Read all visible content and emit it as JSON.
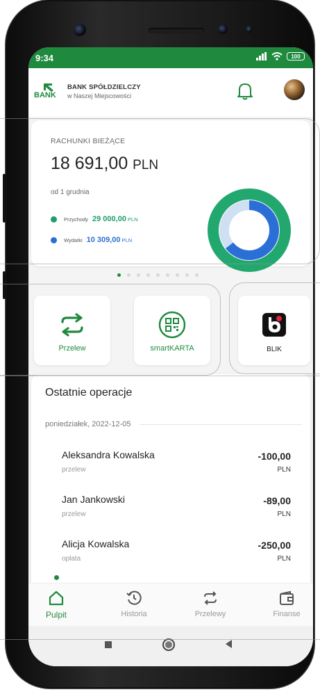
{
  "status_bar": {
    "time": "9:34",
    "battery": "100"
  },
  "header": {
    "logo_text": "BANK",
    "bank_line1": "BANK SPÓŁDZIELCZY",
    "bank_line2": "w Naszej Miejscowości"
  },
  "account_card": {
    "title": "RACHUNKI BIEŻĄCE",
    "balance": "18 691,00",
    "currency": "PLN",
    "since": "od 1 grudnia",
    "income": {
      "label": "Przychody",
      "amount": "29 000,00",
      "currency": "PLN",
      "color": "#1f9e6a"
    },
    "expense": {
      "label": "Wydatki",
      "amount": "10 309,00",
      "currency": "PLN",
      "color": "#2b6fd6"
    }
  },
  "pager": {
    "count": 9,
    "active": 0
  },
  "quick_actions": [
    {
      "label": "Przelew",
      "icon": "transfer-arrows-icon"
    },
    {
      "label": "smartKARTA",
      "icon": "qr-code-icon"
    },
    {
      "label": "BLIK",
      "icon": "blik-logo-icon"
    }
  ],
  "operations": {
    "title": "Ostatnie operacje",
    "date": "poniedziałek, 2022-12-05",
    "items": [
      {
        "name": "Aleksandra Kowalska",
        "type": "przelew",
        "amount": "-100,00",
        "currency": "PLN"
      },
      {
        "name": "Jan Jankowski",
        "type": "przelew",
        "amount": "-89,00",
        "currency": "PLN"
      },
      {
        "name": "Alicja Kowalska",
        "type": "opłata",
        "amount": "-250,00",
        "currency": "PLN"
      }
    ]
  },
  "bottom_nav": [
    {
      "label": "Pulpit",
      "icon": "home-icon",
      "active": true
    },
    {
      "label": "Historia",
      "icon": "history-icon",
      "active": false
    },
    {
      "label": "Przelewy",
      "icon": "transfer-arrows-icon",
      "active": false
    },
    {
      "label": "Finanse",
      "icon": "wallet-icon",
      "active": false
    }
  ],
  "colors": {
    "brand": "#1f8a3e",
    "income": "#1f9e6a",
    "expense": "#2b6fd6"
  }
}
